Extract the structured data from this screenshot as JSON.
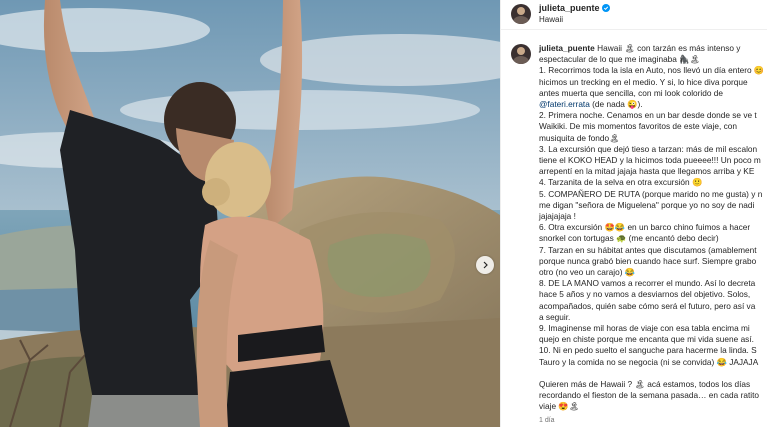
{
  "post": {
    "username": "julieta_puente",
    "location": "Hawaii",
    "verified": true,
    "caption": {
      "username": "julieta_puente",
      "line_1": "Hawaii 🏝 con tarzán es más intenso y",
      "line_2": "espectacular de lo que me imaginaba 🦍🏝",
      "line_3": "1. Recorrimos toda la isla en Auto, nos llevó un día entero 😊",
      "line_4": "hicimos un trecking en el medio. Y si, lo hice diva porque",
      "line_5": "antes muerta que sencilla, con mi look colorido de",
      "line_6_mention": "@fateri.errata",
      "line_6_rest": " (de nada 😜).",
      "line_7": "2. Primera noche. Cenamos en un bar desde donde se ve t",
      "line_8": "Waikiki. De mis momentos favoritos de este viaje, con",
      "line_9": "musiquita de fondo🏝",
      "line_10": "3. La excursión que dejó tieso a tarzan: más de mil escalon",
      "line_11": "tiene el KOKO HEAD y la hicimos toda pueeee!!! Un poco m",
      "line_12": "arrepentí en la mitad jajaja hasta que llegamos arriba y KE",
      "line_13": "4. Tarzanita de la selva en otra excursión 🙂",
      "line_14": "5. COMPAÑERO DE RUTA (porque marido no me gusta) y n",
      "line_15": "me digan \"señora de Miguelena\" porque yo no soy de nadi",
      "line_16": "jajajajaja !",
      "line_17": "6. Otra excursión 🤩😂 en un barco chino fuimos a hacer",
      "line_18": "snorkel con tortugas 🐢 (me encantó debo decir)",
      "line_19": "7. Tarzan en su hábitat antes que discutamos (amablement",
      "line_20": "porque nunca grabó bien cuando hace surf. Siempre grabo",
      "line_21": "otro (no veo un carajo) 😂",
      "line_22": "8. DE LA MANO vamos a recorrer el mundo. Así lo decreta",
      "line_23": "hace 5 años y no vamos a desviarnos del objetivo. Solos,",
      "line_24": "acompañados, quién sabe cómo será el futuro, pero así va",
      "line_25": "a seguir.",
      "line_26": "9. Imaginense mil horas de viaje con esa tabla encima mi",
      "line_27": "quejo en chiste porque me encanta que mi vida suene así.",
      "line_28": "10. Ni en pedo suelto el sanguche para hacerme la linda. S",
      "line_29": "Tauro y la comida no se negocia (ni se convida) 😂 JAJAJA",
      "line_30": "Quieren más de Hawaii ? 🏝 acá estamos, todos los días",
      "line_31": "recordando el fieston de la semana pasada… en cada ratito",
      "line_32": "viaje 😍🏝",
      "timestamp": "1 día"
    }
  },
  "colors": {
    "verified_badge": "#0095f6",
    "mention": "#00376b",
    "muted_text": "#737373"
  },
  "icons": {
    "verified": "verified-badge-icon",
    "next": "chevron-right-icon"
  }
}
